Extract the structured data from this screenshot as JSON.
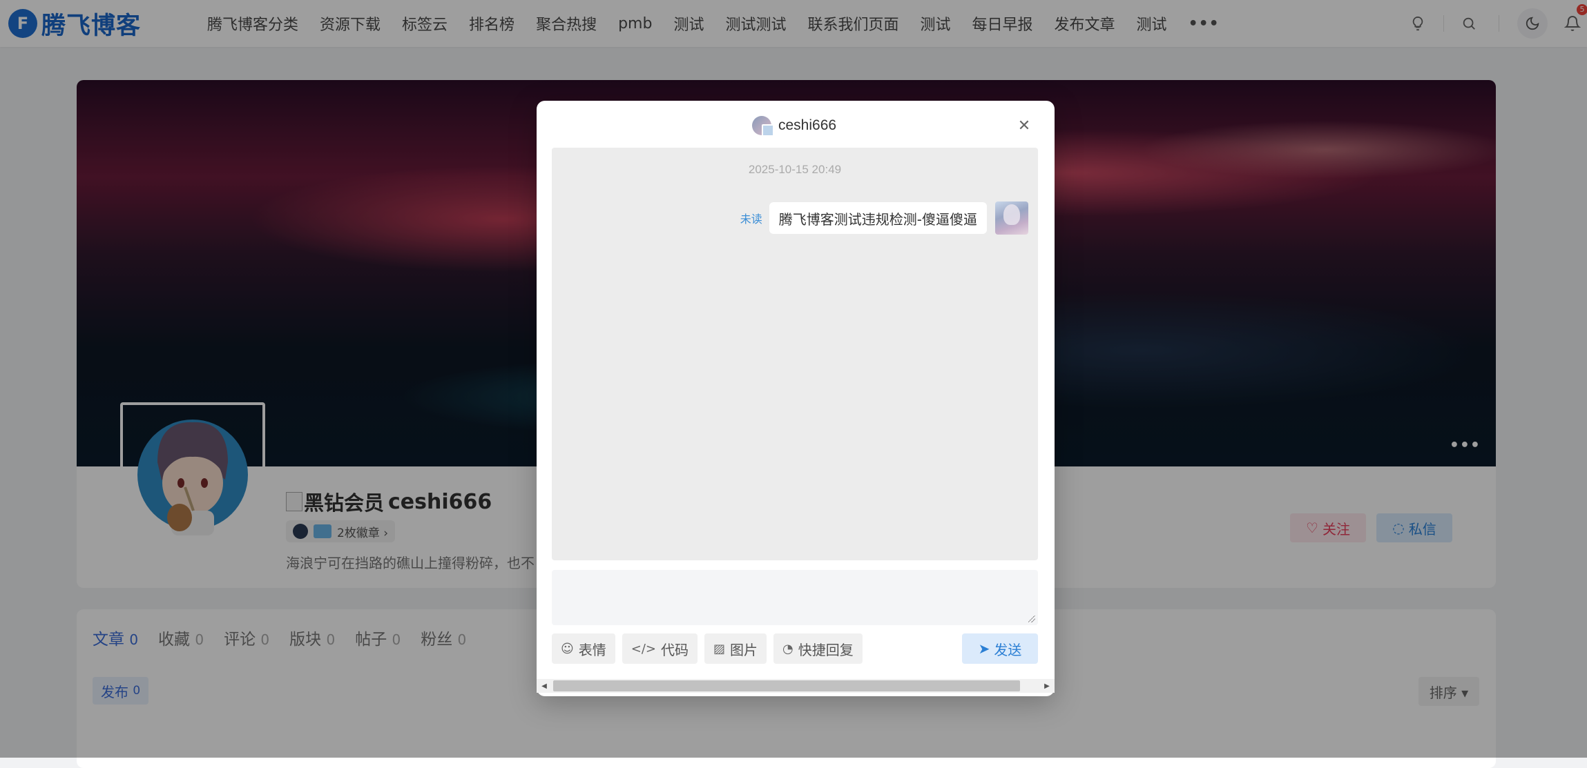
{
  "header": {
    "logo_mark": "F",
    "logo_text": "腾飞博客",
    "nav": [
      "腾飞博客分类",
      "资源下载",
      "标签云",
      "排名榜",
      "聚合热搜",
      "pmb",
      "测试",
      "测试测试",
      "联系我们页面",
      "测试",
      "每日早报",
      "发布文章",
      "测试"
    ],
    "more": "•••",
    "notification_count": "5"
  },
  "cover": {
    "more": "•••"
  },
  "profile": {
    "vip_label": "黑钻会员",
    "username": "ceshi666",
    "badges_label": "2枚徽章 ›",
    "bio": "海浪宁可在挡路的礁山上撞得粉碎，也不",
    "follow_label": "关注",
    "message_label": "私信"
  },
  "tabs": [
    {
      "label": "文章",
      "count": "0"
    },
    {
      "label": "收藏",
      "count": "0"
    },
    {
      "label": "评论",
      "count": "0"
    },
    {
      "label": "版块",
      "count": "0"
    },
    {
      "label": "帖子",
      "count": "0"
    },
    {
      "label": "粉丝",
      "count": "0"
    }
  ],
  "content": {
    "publish_label": "发布",
    "publish_count": "0",
    "sort_label": "排序 ▾"
  },
  "modal": {
    "title": "ceshi666",
    "close": "✕",
    "timestamp": "2025-10-15 20:49",
    "message": {
      "status": "未读",
      "text": "腾飞博客测试违规检测-傻逼傻逼"
    },
    "input_value": "",
    "tools": {
      "emoji": "表情",
      "code": "代码",
      "image": "图片",
      "quick_reply": "快捷回复"
    },
    "send_label": "发送"
  }
}
